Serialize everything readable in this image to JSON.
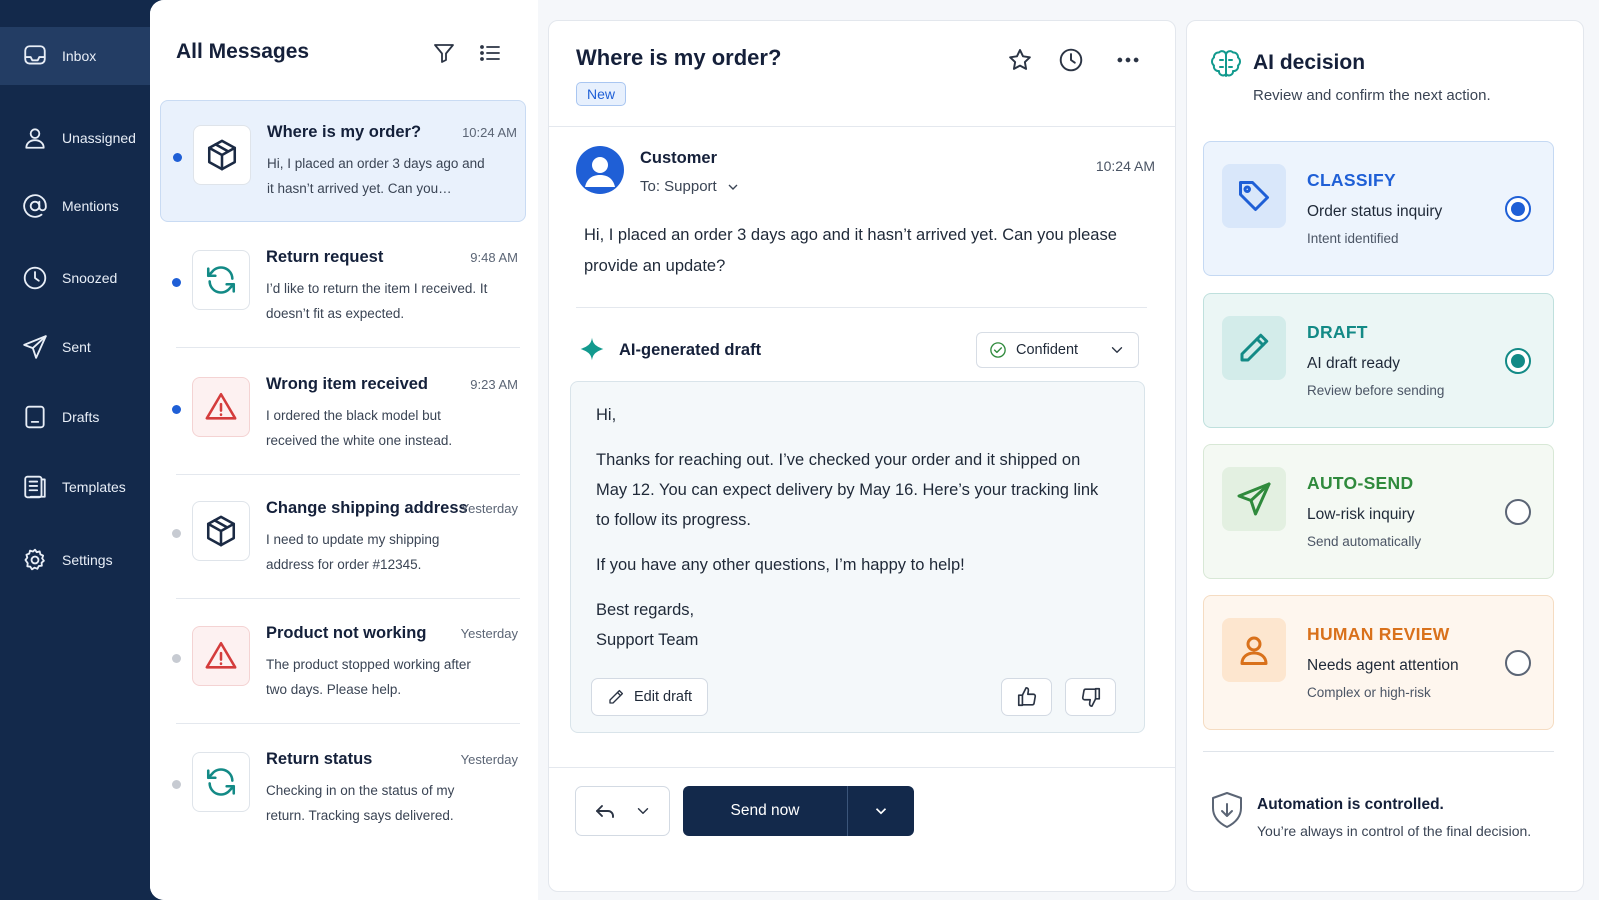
{
  "sidebar": {
    "items": [
      {
        "label": "Inbox",
        "icon": "inbox-icon",
        "active": true
      },
      {
        "label": "Unassigned",
        "icon": "user-icon"
      },
      {
        "label": "Mentions",
        "icon": "at-sign-icon"
      },
      {
        "label": "Snoozed",
        "icon": "clock-icon"
      },
      {
        "label": "Sent",
        "icon": "send-icon"
      },
      {
        "label": "Drafts",
        "icon": "draft-icon"
      },
      {
        "label": "Templates",
        "icon": "templates-icon"
      },
      {
        "label": "Settings",
        "icon": "gear-icon"
      }
    ]
  },
  "list": {
    "title": "All Messages",
    "messages": [
      {
        "subject": "Where is my order?",
        "time": "10:24 AM",
        "preview": "Hi, I placed an order 3 days ago and it hasn’t arrived yet. Can you…",
        "icon": "package-icon",
        "unread": true,
        "selected": true
      },
      {
        "subject": "Return request",
        "time": "9:48 AM",
        "preview": "I’d like to return the item I received. It doesn’t fit as expected.",
        "icon": "refresh-icon",
        "unread": true
      },
      {
        "subject": "Wrong item received",
        "time": "9:23 AM",
        "preview": "I ordered the black model but received the white one instead.",
        "icon": "alert-triangle-icon",
        "unread": true
      },
      {
        "subject": "Change shipping address",
        "time": "Yesterday",
        "preview": "I need to update my shipping address for order #12345.",
        "icon": "package-icon",
        "unread": false
      },
      {
        "subject": "Product not working",
        "time": "Yesterday",
        "preview": "The product stopped working after two days. Please help.",
        "icon": "alert-triangle-icon",
        "unread": false
      },
      {
        "subject": "Return status",
        "time": "Yesterday",
        "preview": "Checking in on the status of my return. Tracking says delivered.",
        "icon": "refresh-icon",
        "unread": false
      }
    ]
  },
  "conversation": {
    "title": "Where is my order?",
    "badge": "New",
    "sender": "Customer",
    "to": "To: Support",
    "time": "10:24 AM",
    "body": "Hi, I placed an order 3 days ago and it hasn’t arrived yet. Can you please provide an update?",
    "draft_label": "AI-generated draft",
    "confidence": "Confident",
    "draft": {
      "greeting": "Hi,",
      "para1": "Thanks for reaching out. I’ve checked your order and it shipped on May 12. You can expect delivery by May 16. Here’s your tracking link to follow its progress.",
      "para2": "If you have any other questions, I’m happy to help!",
      "signoff": "Best regards,",
      "signature": "Support Team"
    },
    "edit_label": "Edit draft",
    "send_label": "Send now"
  },
  "ai": {
    "title": "AI decision",
    "subtitle": "Review and confirm the next action.",
    "options": [
      {
        "head": "CLASSIFY",
        "line": "Order status inquiry",
        "note": "Intent identified",
        "selected": true,
        "icon": "tag-icon",
        "color": "#1f5fd6"
      },
      {
        "head": "DRAFT",
        "line": "AI draft ready",
        "note": "Review before sending",
        "selected": true,
        "icon": "pencil-icon",
        "color": "#138a86"
      },
      {
        "head": "AUTO-SEND",
        "line": "Low-risk inquiry",
        "note": "Send automatically",
        "selected": false,
        "icon": "send-icon",
        "color": "#2f8a3c"
      },
      {
        "head": "HUMAN REVIEW",
        "line": "Needs agent attention",
        "note": "Complex or high-risk",
        "selected": false,
        "icon": "person-icon",
        "color": "#d9711b"
      }
    ],
    "control_title": "Automation is controlled.",
    "control_sub": "You’re always in control of the final decision."
  },
  "colors": {
    "sidebar_bg": "#13294b",
    "accent_blue": "#1f5fd6",
    "teal": "#138a86",
    "green": "#2f8a3c",
    "orange": "#d9711b",
    "alert_red": "#d43c3c"
  }
}
